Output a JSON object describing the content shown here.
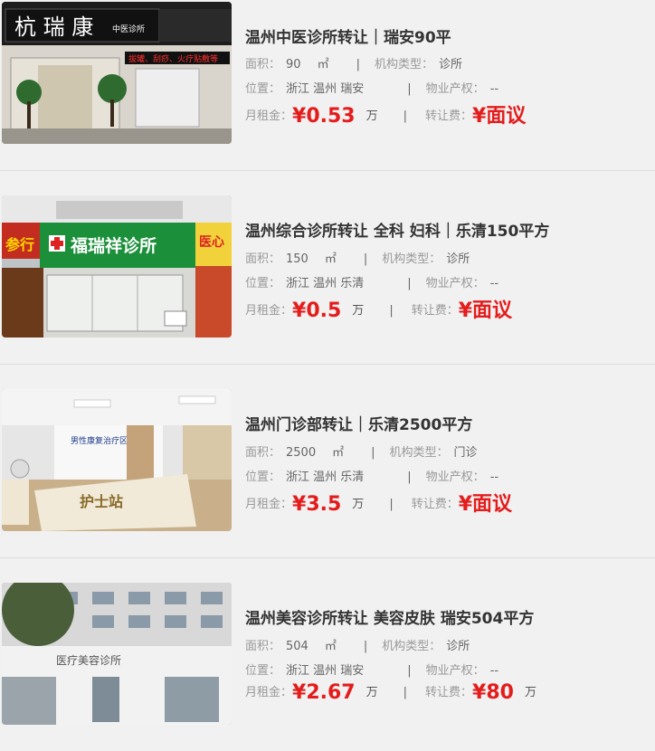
{
  "listings": [
    {
      "title": "温州中医诊所转让｜瑞安90平",
      "area_label": "面积：",
      "area": "90",
      "area_unit": "㎡",
      "type_label": "机构类型：",
      "type": "诊所",
      "location_label": "位置：",
      "location": "浙江 温州 瑞安",
      "property_label": "物业产权：",
      "property": "--",
      "rent_label": "月租金：",
      "rent": "¥0.53",
      "rent_unit": "万",
      "fee_label": "转让费：",
      "fee": "¥面议",
      "fee_unit": "",
      "sign_text": "杭 瑞 康",
      "sign_sub": "中医诊所",
      "led_text": "拔罐、刮痧、火疗贴敷等"
    },
    {
      "title": "温州综合诊所转让 全科 妇科｜乐清150平方",
      "area_label": "面积：",
      "area": "150",
      "area_unit": "㎡",
      "type_label": "机构类型：",
      "type": "诊所",
      "location_label": "位置：",
      "location": "浙江 温州 乐清",
      "property_label": "物业产权：",
      "property": "--",
      "rent_label": "月租金：",
      "rent": "¥0.5",
      "rent_unit": "万",
      "fee_label": "转让费：",
      "fee": "¥面议",
      "fee_unit": "",
      "sign_text": "福瑞祥诊所"
    },
    {
      "title": "温州门诊部转让｜乐清2500平方",
      "area_label": "面积：",
      "area": "2500",
      "area_unit": "㎡",
      "type_label": "机构类型：",
      "type": "门诊",
      "location_label": "位置：",
      "location": "浙江 温州 乐清",
      "property_label": "物业产权：",
      "property": "--",
      "rent_label": "月租金：",
      "rent": "¥3.5",
      "rent_unit": "万",
      "fee_label": "转让费：",
      "fee": "¥面议",
      "fee_unit": "",
      "sign_text": "护士站",
      "wall_text": "男性康复治疗区"
    },
    {
      "title": "温州美容诊所转让 美容皮肤 瑞安504平方",
      "area_label": "面积：",
      "area": "504",
      "area_unit": "㎡",
      "type_label": "机构类型：",
      "type": "诊所",
      "location_label": "位置：",
      "location": "浙江 温州 瑞安",
      "property_label": "物业产权：",
      "property": "--",
      "rent_label": "月租金：",
      "rent": "¥2.67",
      "rent_unit": "万",
      "fee_label": "转让费：",
      "fee": "¥80",
      "fee_unit": "万",
      "sign_text": "医疗美容诊所"
    }
  ]
}
